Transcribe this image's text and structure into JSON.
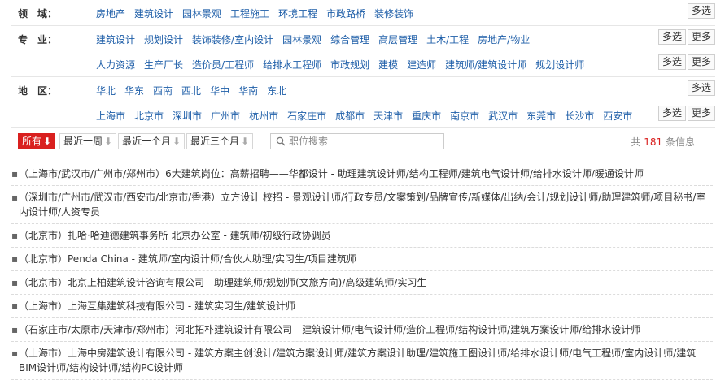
{
  "filters": [
    {
      "label": "领　域：",
      "items": [
        "房地产",
        "建筑设计",
        "园林景观",
        "工程施工",
        "环境工程",
        "市政路桥",
        "装修装饰"
      ],
      "buttons": [
        "多选"
      ]
    },
    {
      "label": "专　业：",
      "items": [
        "建筑设计",
        "规划设计",
        "装饰装修/室内设计",
        "园林景观",
        "综合管理",
        "高层管理",
        "土木/工程",
        "房地产/物业"
      ],
      "buttons": [
        "多选",
        "更多"
      ]
    },
    {
      "label": "",
      "items": [
        "人力资源",
        "生产厂长",
        "造价员/工程师",
        "给排水工程师",
        "市政规划",
        "建模",
        "建造师",
        "建筑师/建筑设计师",
        "规划设计师"
      ],
      "buttons": [
        "多选",
        "更多"
      ]
    },
    {
      "label": "地　区：",
      "items": [
        "华北",
        "华东",
        "西南",
        "西北",
        "华中",
        "华南",
        "东北"
      ],
      "buttons": [
        "多选"
      ]
    },
    {
      "label": "",
      "items": [
        "上海市",
        "北京市",
        "深圳市",
        "广州市",
        "杭州市",
        "石家庄市",
        "成都市",
        "天津市",
        "重庆市",
        "南京市",
        "武汉市",
        "东莞市",
        "长沙市",
        "西安市"
      ],
      "buttons": [
        "多选",
        "更多"
      ]
    }
  ],
  "sort": {
    "options": [
      "所有",
      "最近一周",
      "最近一个月",
      "最近三个月"
    ],
    "arrow": "⬇"
  },
  "search": {
    "placeholder": "职位搜索",
    "icon": "search-icon"
  },
  "count": {
    "prefix": "共",
    "number": "181",
    "suffix": "条信息"
  },
  "accent_color": "#d9201f",
  "link_color": "#1e5ea8",
  "jobs": [
    "（上海市/武汉市/广州市/郑州市）6大建筑岗位：高薪招聘——华都设计 - 助理建筑设计师/结构工程师/建筑电气设计师/给排水设计师/暖通设计师",
    "（深圳市/广州市/武汉市/西安市/北京市/香港）立方设计 校招 - 景观设计师/行政专员/文案策划/品牌宣传/新媒体/出纳/会计/规划设计师/助理建筑师/项目秘书/室内设计师/人资专员",
    "（北京市）扎哈·哈迪德建筑事务所 北京办公室 - 建筑师/初级行政协调员",
    "（北京市）Penda China - 建筑师/室内设计师/合伙人助理/实习生/项目建筑师",
    "（北京市）北京上柏建筑设计咨询有限公司 - 助理建筑师/规划师(文旅方向)/高级建筑师/实习生",
    "（上海市）上海互集建筑科技有限公司 - 建筑实习生/建筑设计师",
    "（石家庄市/太原市/天津市/郑州市）河北拓朴建筑设计有限公司 - 建筑设计师/电气设计师/造价工程师/结构设计师/建筑方案设计师/给排水设计师",
    "（上海市）上海中房建筑设计有限公司 - 建筑方案主创设计/建筑方案设计师/建筑方案设计助理/建筑施工图设计师/给排水设计师/电气工程师/室内设计师/建筑BIM设计师/结构设计师/结构PC设计师"
  ]
}
